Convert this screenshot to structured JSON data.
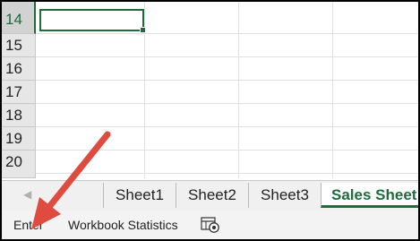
{
  "rows": [
    "14",
    "15",
    "16",
    "17",
    "18",
    "19",
    "20"
  ],
  "tabs": [
    "Sheet1",
    "Sheet2",
    "Sheet3",
    "Sales Sheet"
  ],
  "status": {
    "mode": "Enter",
    "workbook_statistics": "Workbook Statistics"
  },
  "icons": {
    "scroll_left": "triangle-left",
    "statistics": "workbook-statistics-icon"
  },
  "colors": {
    "accent": "#1e6b3c",
    "annotation_arrow": "#e04b3f"
  }
}
